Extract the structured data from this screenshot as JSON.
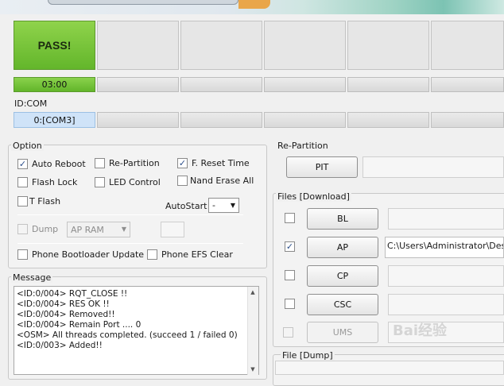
{
  "slots": {
    "status": "PASS!",
    "time": "03:00",
    "id_com_label": "ID:COM",
    "com_port": "0:[COM3]"
  },
  "option": {
    "title": "Option",
    "auto_reboot": "Auto Reboot",
    "re_partition": "Re-Partition",
    "f_reset_time": "F. Reset Time",
    "flash_lock": "Flash Lock",
    "led_control": "LED Control",
    "nand_erase_all": "Nand Erase All",
    "t_flash": "T Flash",
    "autostart_label": "AutoStart",
    "autostart_value": "-",
    "dump": "Dump",
    "dump_target": "AP RAM",
    "phone_bootloader_update": "Phone Bootloader Update",
    "phone_efs_clear": "Phone EFS Clear",
    "checked_symbol": "✓"
  },
  "message": {
    "title": "Message",
    "lines": [
      "<ID:0/004> RQT_CLOSE !!",
      "<ID:0/004> RES OK !!",
      "<ID:0/004> Removed!!",
      "<ID:0/004> Remain Port ....  0",
      "<OSM> All threads completed. (succeed 1 / failed 0)",
      "<ID:0/003> Added!!"
    ]
  },
  "repartition": {
    "title": "Re-Partition",
    "pit_button": "PIT"
  },
  "files": {
    "title": "Files [Download]",
    "bl_button": "BL",
    "ap_button": "AP",
    "ap_path": "C:\\Users\\Administrator\\Desktop",
    "cp_button": "CP",
    "csc_button": "CSC",
    "ums_button": "UMS"
  },
  "file_dump": {
    "title": "File [Dump]"
  },
  "watermark": "Bai经验"
}
